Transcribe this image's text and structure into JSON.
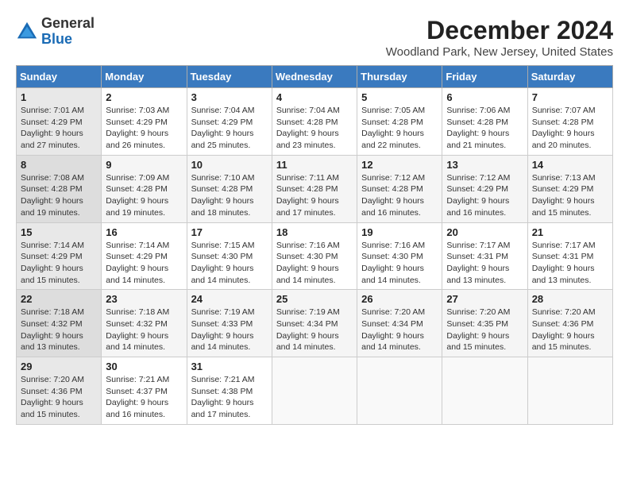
{
  "header": {
    "logo_general": "General",
    "logo_blue": "Blue",
    "month_title": "December 2024",
    "location": "Woodland Park, New Jersey, United States"
  },
  "days_of_week": [
    "Sunday",
    "Monday",
    "Tuesday",
    "Wednesday",
    "Thursday",
    "Friday",
    "Saturday"
  ],
  "weeks": [
    [
      {
        "day": "1",
        "sunrise": "Sunrise: 7:01 AM",
        "sunset": "Sunset: 4:29 PM",
        "daylight": "Daylight: 9 hours and 27 minutes."
      },
      {
        "day": "2",
        "sunrise": "Sunrise: 7:03 AM",
        "sunset": "Sunset: 4:29 PM",
        "daylight": "Daylight: 9 hours and 26 minutes."
      },
      {
        "day": "3",
        "sunrise": "Sunrise: 7:04 AM",
        "sunset": "Sunset: 4:29 PM",
        "daylight": "Daylight: 9 hours and 25 minutes."
      },
      {
        "day": "4",
        "sunrise": "Sunrise: 7:04 AM",
        "sunset": "Sunset: 4:28 PM",
        "daylight": "Daylight: 9 hours and 23 minutes."
      },
      {
        "day": "5",
        "sunrise": "Sunrise: 7:05 AM",
        "sunset": "Sunset: 4:28 PM",
        "daylight": "Daylight: 9 hours and 22 minutes."
      },
      {
        "day": "6",
        "sunrise": "Sunrise: 7:06 AM",
        "sunset": "Sunset: 4:28 PM",
        "daylight": "Daylight: 9 hours and 21 minutes."
      },
      {
        "day": "7",
        "sunrise": "Sunrise: 7:07 AM",
        "sunset": "Sunset: 4:28 PM",
        "daylight": "Daylight: 9 hours and 20 minutes."
      }
    ],
    [
      {
        "day": "8",
        "sunrise": "Sunrise: 7:08 AM",
        "sunset": "Sunset: 4:28 PM",
        "daylight": "Daylight: 9 hours and 19 minutes."
      },
      {
        "day": "9",
        "sunrise": "Sunrise: 7:09 AM",
        "sunset": "Sunset: 4:28 PM",
        "daylight": "Daylight: 9 hours and 19 minutes."
      },
      {
        "day": "10",
        "sunrise": "Sunrise: 7:10 AM",
        "sunset": "Sunset: 4:28 PM",
        "daylight": "Daylight: 9 hours and 18 minutes."
      },
      {
        "day": "11",
        "sunrise": "Sunrise: 7:11 AM",
        "sunset": "Sunset: 4:28 PM",
        "daylight": "Daylight: 9 hours and 17 minutes."
      },
      {
        "day": "12",
        "sunrise": "Sunrise: 7:12 AM",
        "sunset": "Sunset: 4:28 PM",
        "daylight": "Daylight: 9 hours and 16 minutes."
      },
      {
        "day": "13",
        "sunrise": "Sunrise: 7:12 AM",
        "sunset": "Sunset: 4:29 PM",
        "daylight": "Daylight: 9 hours and 16 minutes."
      },
      {
        "day": "14",
        "sunrise": "Sunrise: 7:13 AM",
        "sunset": "Sunset: 4:29 PM",
        "daylight": "Daylight: 9 hours and 15 minutes."
      }
    ],
    [
      {
        "day": "15",
        "sunrise": "Sunrise: 7:14 AM",
        "sunset": "Sunset: 4:29 PM",
        "daylight": "Daylight: 9 hours and 15 minutes."
      },
      {
        "day": "16",
        "sunrise": "Sunrise: 7:14 AM",
        "sunset": "Sunset: 4:29 PM",
        "daylight": "Daylight: 9 hours and 14 minutes."
      },
      {
        "day": "17",
        "sunrise": "Sunrise: 7:15 AM",
        "sunset": "Sunset: 4:30 PM",
        "daylight": "Daylight: 9 hours and 14 minutes."
      },
      {
        "day": "18",
        "sunrise": "Sunrise: 7:16 AM",
        "sunset": "Sunset: 4:30 PM",
        "daylight": "Daylight: 9 hours and 14 minutes."
      },
      {
        "day": "19",
        "sunrise": "Sunrise: 7:16 AM",
        "sunset": "Sunset: 4:30 PM",
        "daylight": "Daylight: 9 hours and 14 minutes."
      },
      {
        "day": "20",
        "sunrise": "Sunrise: 7:17 AM",
        "sunset": "Sunset: 4:31 PM",
        "daylight": "Daylight: 9 hours and 13 minutes."
      },
      {
        "day": "21",
        "sunrise": "Sunrise: 7:17 AM",
        "sunset": "Sunset: 4:31 PM",
        "daylight": "Daylight: 9 hours and 13 minutes."
      }
    ],
    [
      {
        "day": "22",
        "sunrise": "Sunrise: 7:18 AM",
        "sunset": "Sunset: 4:32 PM",
        "daylight": "Daylight: 9 hours and 13 minutes."
      },
      {
        "day": "23",
        "sunrise": "Sunrise: 7:18 AM",
        "sunset": "Sunset: 4:32 PM",
        "daylight": "Daylight: 9 hours and 14 minutes."
      },
      {
        "day": "24",
        "sunrise": "Sunrise: 7:19 AM",
        "sunset": "Sunset: 4:33 PM",
        "daylight": "Daylight: 9 hours and 14 minutes."
      },
      {
        "day": "25",
        "sunrise": "Sunrise: 7:19 AM",
        "sunset": "Sunset: 4:34 PM",
        "daylight": "Daylight: 9 hours and 14 minutes."
      },
      {
        "day": "26",
        "sunrise": "Sunrise: 7:20 AM",
        "sunset": "Sunset: 4:34 PM",
        "daylight": "Daylight: 9 hours and 14 minutes."
      },
      {
        "day": "27",
        "sunrise": "Sunrise: 7:20 AM",
        "sunset": "Sunset: 4:35 PM",
        "daylight": "Daylight: 9 hours and 15 minutes."
      },
      {
        "day": "28",
        "sunrise": "Sunrise: 7:20 AM",
        "sunset": "Sunset: 4:36 PM",
        "daylight": "Daylight: 9 hours and 15 minutes."
      }
    ],
    [
      {
        "day": "29",
        "sunrise": "Sunrise: 7:20 AM",
        "sunset": "Sunset: 4:36 PM",
        "daylight": "Daylight: 9 hours and 15 minutes."
      },
      {
        "day": "30",
        "sunrise": "Sunrise: 7:21 AM",
        "sunset": "Sunset: 4:37 PM",
        "daylight": "Daylight: 9 hours and 16 minutes."
      },
      {
        "day": "31",
        "sunrise": "Sunrise: 7:21 AM",
        "sunset": "Sunset: 4:38 PM",
        "daylight": "Daylight: 9 hours and 17 minutes."
      },
      null,
      null,
      null,
      null
    ]
  ]
}
